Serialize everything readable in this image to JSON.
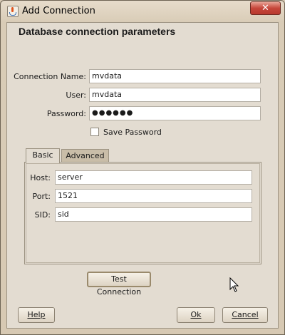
{
  "window": {
    "title": "Add Connection",
    "close_glyph": "✕",
    "app_icon": "java-cup-icon"
  },
  "header": {
    "title": "Database connection parameters"
  },
  "form": {
    "connection_name": {
      "label": "Connection Name:",
      "value": "mvdata"
    },
    "user": {
      "label": "User:",
      "value": "mvdata"
    },
    "password": {
      "label": "Password:",
      "value": "●●●●●●"
    },
    "save_password": {
      "label": "Save Password",
      "checked": false
    }
  },
  "tabs": [
    {
      "label": "Basic",
      "active": true
    },
    {
      "label": "Advanced",
      "active": false
    }
  ],
  "basic": {
    "host": {
      "label": "Host:",
      "value": "server"
    },
    "port": {
      "label": "Port:",
      "value": "1521"
    },
    "sid": {
      "label": "SID:",
      "value": "sid"
    }
  },
  "buttons": {
    "test_connection": "Test Connection",
    "help": "Help",
    "ok": "Ok",
    "cancel": "Cancel"
  },
  "colors": {
    "close_button": "#c6463a",
    "background": "#e3dcd1"
  }
}
